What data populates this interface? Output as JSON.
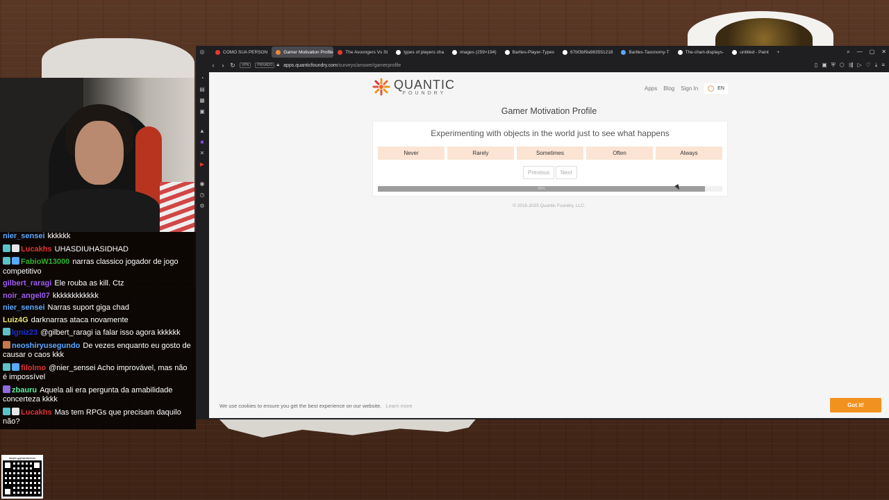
{
  "chat": [
    {
      "user": "nier_sensei",
      "color": "#5aa8ff",
      "text": "kkkkkk",
      "badges": []
    },
    {
      "user": "Lucakhs",
      "color": "#e03232",
      "text": "UHASDIUHASIDHAD",
      "badges": [
        "#5cc1c9",
        "#e6e6e6"
      ]
    },
    {
      "user": "FabioW13000",
      "color": "#2fb12f",
      "text": "narras classico jogador de jogo competitivo",
      "badges": [
        "#5cc1c9",
        "#5aa8ff"
      ]
    },
    {
      "user": "gilbert_raragi",
      "color": "#9a5cf2",
      "text": "Ele rouba as kill. Ctz",
      "badges": []
    },
    {
      "user": "noir_angel07",
      "color": "#9a5cf2",
      "text": "kkkkkkkkkkkk",
      "badges": []
    },
    {
      "user": "nier_sensei",
      "color": "#5aa8ff",
      "text": "Narras suport giga chad",
      "badges": []
    },
    {
      "user": "Luiz4G",
      "color": "#e8e86a",
      "text": "darknarras ataca novamente",
      "badges": []
    },
    {
      "user": "lgniz23",
      "color": "#1d2bd6",
      "text": "@gilbert_raragi ia falar isso agora kkkkkk",
      "badges": [
        "#5cc1c9"
      ]
    },
    {
      "user": "neoshiryusegundo",
      "color": "#5aa8ff",
      "text": "De vezes enquanto eu gosto de causar o caos kkk",
      "badges": [
        "#c9784a"
      ]
    },
    {
      "user": "filolmo",
      "color": "#e03232",
      "text": "@nier_sensei Acho improvável, mas não é impossível",
      "badges": [
        "#5cc1c9",
        "#5aa8ff"
      ]
    },
    {
      "user": "zbauru",
      "color": "#5cf2a4",
      "text": "Aquela ali era pergunta da amabilidade concerteza kkkk",
      "badges": [
        "#8f6ae0"
      ]
    },
    {
      "user": "Lucakhs",
      "color": "#e03232",
      "text": "Mas tem RPGs que precisam daquilo não?",
      "badges": [
        "#5cc1c9",
        "#e6e6e6"
      ]
    }
  ],
  "qr_label": "livepix.gg/narrandono",
  "tabs": [
    {
      "label": "COMO SUA PERSON",
      "color": "#e53935",
      "active": false
    },
    {
      "label": "Gamer Motivation Profile",
      "color": "#e8893a",
      "active": true
    },
    {
      "label": "The Avoongers Vs St",
      "color": "#e53935",
      "active": false
    },
    {
      "label": "types of players cha",
      "color": "#ffffff",
      "active": false
    },
    {
      "label": "images (259×194)",
      "color": "#ffffff",
      "active": false
    },
    {
      "label": "Bartles-Player-Types",
      "color": "#ffffff",
      "active": false
    },
    {
      "label": "67bf3bf9a983551218",
      "color": "#ffffff",
      "active": false
    },
    {
      "label": "Bartles-Taxonomy-T",
      "color": "#5aa8ff",
      "active": false
    },
    {
      "label": "The-chart-displays-",
      "color": "#ffffff",
      "active": false
    },
    {
      "label": "untitled - Paint",
      "color": "#ffffff",
      "active": false
    }
  ],
  "address": {
    "vpn": "VPN",
    "private": "PRIVADO",
    "domain": "apps.quanticfoundry.com",
    "path": "/surveys/answer/gamerprofile"
  },
  "site": {
    "logo_main": "QUANTIC",
    "logo_sub": "FOUNDRY",
    "nav": [
      "Apps",
      "Blog",
      "Sign In"
    ],
    "lang": "EN",
    "page_title": "Gamer Motivation Profile",
    "question": "Experimenting with objects in the world just to see what happens",
    "answers": [
      "Never",
      "Rarely",
      "Sometimes",
      "Often",
      "Always"
    ],
    "previous": "Previous",
    "next": "Next",
    "progress_label": "95%",
    "progress_value": 0.95,
    "copyright": "© 2015-2025 Quantic Foundry, LLC.",
    "cookie_text": "We use cookies to ensure you get the best experience on our website.",
    "cookie_link": "Learn more",
    "cookie_button": "Got it!"
  },
  "colors": {
    "accent": "#f2921e",
    "answer_bg": "#fbe4d3"
  }
}
